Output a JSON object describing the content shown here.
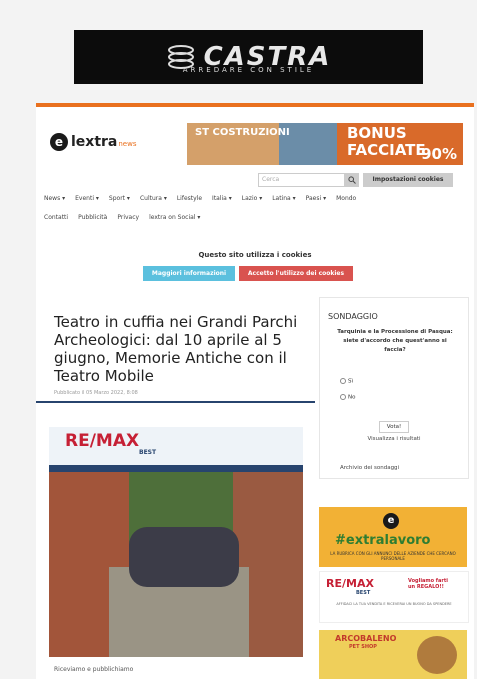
{
  "top_banner": {
    "brand": "CASTRA",
    "tagline": "ARREDARE CON STILE"
  },
  "site": {
    "logo": {
      "letter": "e",
      "word": "lextra",
      "suffix": "news"
    },
    "ad_banner": {
      "left_text": "ST COSTRUZIONI",
      "right_text": "BONUS FACCIATE",
      "percent": "90%"
    },
    "search": {
      "placeholder": "Cerca",
      "button_icon": "search-icon"
    },
    "cookie_settings_label": "Impostazioni cookies",
    "nav_row1": [
      "News ▾",
      "Eventi ▾",
      "Sport ▾",
      "Cultura ▾",
      "Lifestyle",
      "Italia ▾",
      "Lazio ▾",
      "Latina ▾",
      "Paesi ▾",
      "Mondo"
    ],
    "nav_row2": [
      "Contatti",
      "Pubblicità",
      "Privacy",
      "lextra on Social ▾"
    ],
    "cookie_notice": "Questo sito utilizza i cookies",
    "cookie_more": "Maggiori informazioni",
    "cookie_accept": "Accetto l'utilizzo dei cookies"
  },
  "article": {
    "title": "Teatro in cuffia nei Grandi Parchi Archeologici: dal 10 aprile al 5 giugno, Memorie Antiche con il Teatro Mobile",
    "date": "Pubblicato il 05 Marzo 2022, 8:08",
    "photo_brand": "RE/MAX",
    "photo_brand_sub": "BEST",
    "caption": "Riceviamo e pubblichiamo"
  },
  "poll": {
    "heading": "SONDAGGIO",
    "question": "Tarquinia e la Processione di Pasqua: siete d'accordo che quest'anno si faccia?",
    "options": [
      "Sì",
      "No"
    ],
    "vote_label": "Vota!",
    "results_label": "Visualizza i risultati",
    "archive_label": "Archivio dei sondaggi"
  },
  "ads": {
    "extralavoro": {
      "hashtag": "#extralavoro",
      "letter": "e",
      "subtitle": "LA RUBRICA CON GLI ANNUNCI DELLE AZIENDE CHE CERCANO PERSONALE"
    },
    "remax": {
      "brand": "RE/MAX",
      "sub": "BEST",
      "text": "Vogliamo farti un REGALO!!",
      "small": "AFFIDACI LA TUA VENDITA E RICEVERAI UN BUONO DA SPENDERE"
    },
    "pet": {
      "title": "ARCOBALENO",
      "subtitle": "PET SHOP"
    }
  },
  "colors": {
    "accent": "#e9701e",
    "navy": "#27446e",
    "remax_red": "#c62035"
  }
}
